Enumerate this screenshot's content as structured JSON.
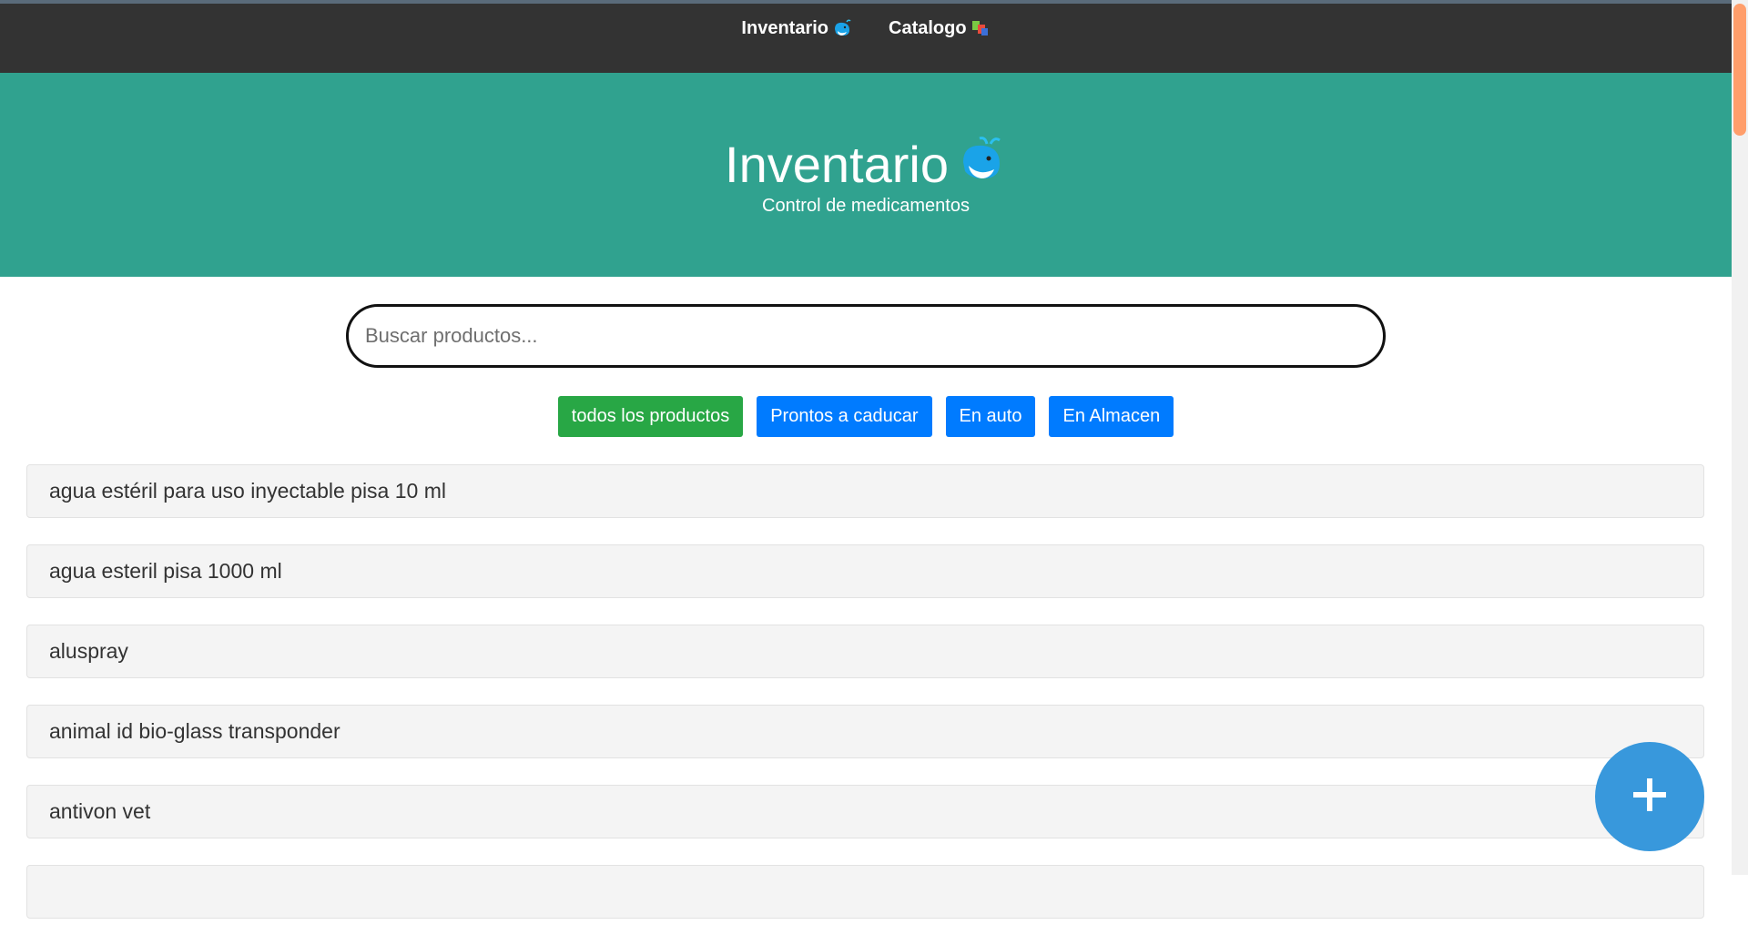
{
  "nav": {
    "links": [
      {
        "label": "Inventario",
        "icon": "whale-icon"
      },
      {
        "label": "Catalogo",
        "icon": "books-icon"
      }
    ]
  },
  "hero": {
    "title": "Inventario",
    "subtitle": "Control de medicamentos"
  },
  "search": {
    "placeholder": "Buscar productos...",
    "value": ""
  },
  "filters": [
    {
      "label": "todos los productos",
      "color": "#28a745"
    },
    {
      "label": "Prontos a caducar",
      "color": "#007bff"
    },
    {
      "label": "En auto",
      "color": "#007bff"
    },
    {
      "label": "En Almacen",
      "color": "#007bff"
    }
  ],
  "products": [
    "agua estéril para uso inyectable pisa 10 ml",
    "agua esteril pisa 1000 ml",
    "aluspray",
    "animal id bio-glass transponder",
    "antivon vet",
    ""
  ],
  "fab": {
    "icon": "plus-icon"
  },
  "colors": {
    "navbar": "#333333",
    "hero": "#30a28f",
    "fab": "#3898dc"
  }
}
